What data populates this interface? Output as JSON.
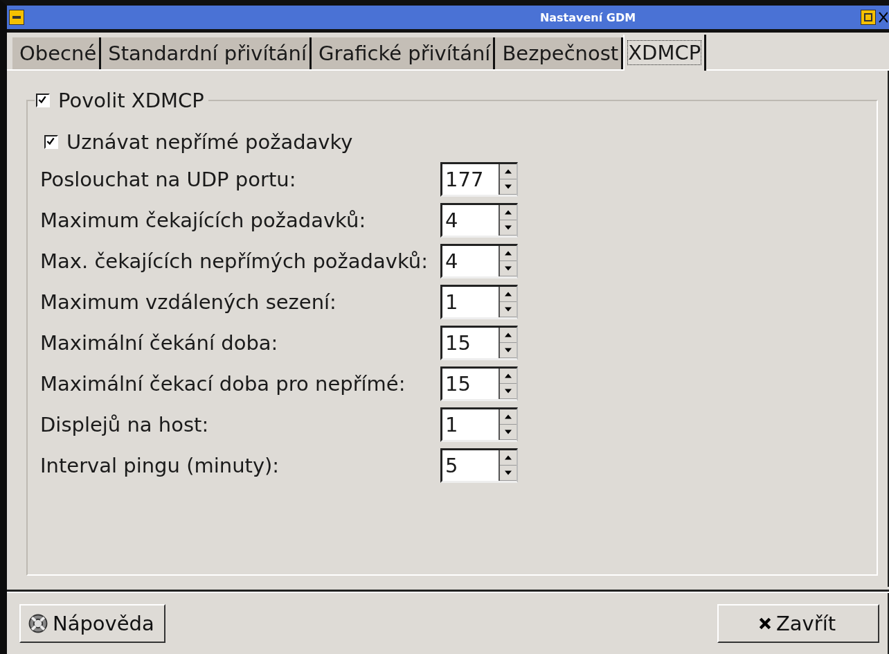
{
  "window": {
    "title": "Nastavení GDM"
  },
  "tabs": [
    {
      "label": "Obecné",
      "selected": false
    },
    {
      "label": "Standardní přivítání",
      "selected": false
    },
    {
      "label": "Grafické přivítání",
      "selected": false
    },
    {
      "label": "Bezpečnost",
      "selected": false
    },
    {
      "label": "XDMCP",
      "selected": true
    }
  ],
  "frame": {
    "label": "Povolit XDMCP",
    "checked": true
  },
  "options": [
    {
      "label": "Uznávat nepřímé požadavky",
      "checked": true
    }
  ],
  "spin_rows": [
    {
      "label": "Poslouchat na UDP portu:",
      "value": "177"
    },
    {
      "label": "Maximum čekajících požadavků:",
      "value": "4"
    },
    {
      "label": "Max. čekajících nepřímých požadavků:",
      "value": "4"
    },
    {
      "label": "Maximum vzdálených sezení:",
      "value": "1"
    },
    {
      "label": "Maximální čekání doba:",
      "value": "15"
    },
    {
      "label": "Maximální čekací doba pro nepřímé:",
      "value": "15"
    },
    {
      "label": "Displejů na host:",
      "value": "1"
    },
    {
      "label": "Interval pingu (minuty):",
      "value": "5"
    }
  ],
  "buttons": [
    {
      "kind": "help",
      "label": "Nápověda"
    },
    {
      "kind": "close",
      "label": "Zavřít"
    }
  ]
}
